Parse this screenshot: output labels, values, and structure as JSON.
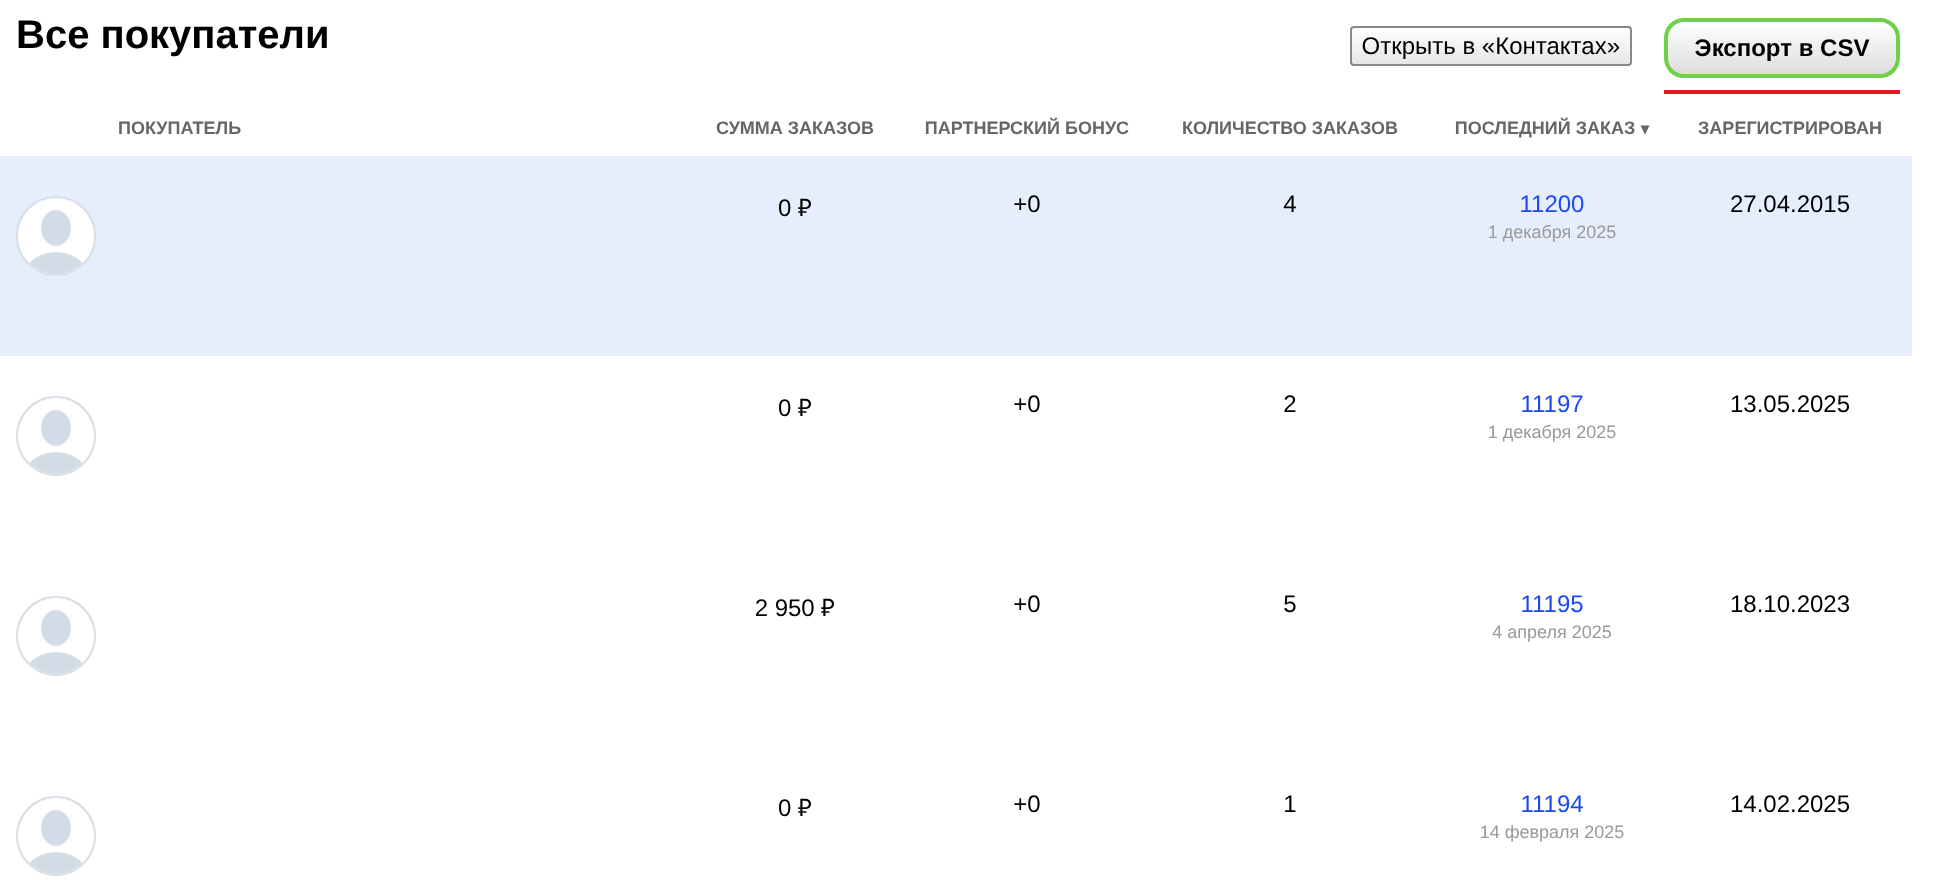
{
  "page": {
    "title": "Все покупатели"
  },
  "actions": [
    {
      "label": "Открыть в «Контактах»",
      "kind": "plain"
    },
    {
      "label": "Экспорт в CSV",
      "kind": "primary"
    }
  ],
  "table": {
    "columns": [
      {
        "label": "ПОКУПАТЕЛЬ"
      },
      {
        "label": "СУММА ЗАКАЗОВ"
      },
      {
        "label": "ПАРТНЕРСКИЙ БОНУС"
      },
      {
        "label": "КОЛИЧЕСТВО ЗАКАЗОВ"
      },
      {
        "label": "ПОСЛЕДНИЙ ЗАКАЗ",
        "sort": "▾"
      },
      {
        "label": "ЗАРЕГИСТРИРОВАН"
      }
    ],
    "rows": [
      {
        "selected": true,
        "sum": "0 ₽",
        "bonus": "+0",
        "count": "4",
        "order": "11200",
        "order_date": "1 декабря 2025",
        "registered": "27.04.2015"
      },
      {
        "selected": false,
        "sum": "0 ₽",
        "bonus": "+0",
        "count": "2",
        "order": "11197",
        "order_date": "1 декабря 2025",
        "registered": "13.05.2025"
      },
      {
        "selected": false,
        "sum": "2 950 ₽",
        "bonus": "+0",
        "count": "5",
        "order": "11195",
        "order_date": "4 апреля 2025",
        "registered": "18.10.2023"
      },
      {
        "selected": false,
        "sum": "0 ₽",
        "bonus": "+0",
        "count": "1",
        "order": "11194",
        "order_date": "14 февраля 2025",
        "registered": "14.02.2025"
      }
    ]
  }
}
